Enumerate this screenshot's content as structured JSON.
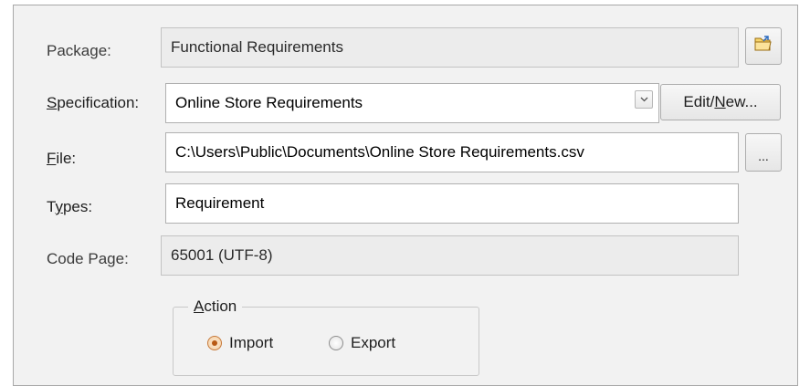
{
  "form": {
    "package": {
      "label": "Package:",
      "value": "Functional Requirements"
    },
    "specification": {
      "label_prefix": "S",
      "label_rest": "pecification:",
      "value": "Online Store Requirements",
      "edit_button_prefix": "Edit/",
      "edit_button_u": "N",
      "edit_button_rest": "ew..."
    },
    "file": {
      "label_u": "F",
      "label_rest": "ile:",
      "value": "C:\\Users\\Public\\Documents\\Online Store Requirements.csv",
      "browse_label": "..."
    },
    "types": {
      "label_pre": "T",
      "label_u": "y",
      "label_rest": "pes:",
      "value": "Requirement"
    },
    "code_page": {
      "label": "Code Page:",
      "value": "65001 (UTF-8)"
    }
  },
  "action": {
    "legend_u": "A",
    "legend_rest": "ction",
    "options": [
      {
        "label": "Import",
        "checked": true
      },
      {
        "label": "Export",
        "checked": false
      }
    ]
  },
  "icons": {
    "package_browse": "folder-open-icon",
    "spec_dropdown": "chevron-down-icon"
  },
  "colors": {
    "radio_accent": "#b85a14",
    "dialog_bg": "#f2f2f2"
  }
}
